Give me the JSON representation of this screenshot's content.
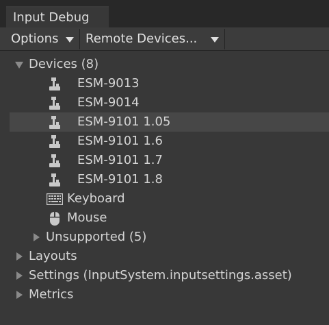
{
  "window": {
    "tab_title": "Input Debug"
  },
  "toolbar": {
    "options_label": "Options",
    "remote_label": "Remote Devices..."
  },
  "tree": {
    "devices": {
      "label": "Devices (8)",
      "items": [
        {
          "label": "ESM-9013",
          "icon": "joystick-icon"
        },
        {
          "label": "ESM-9014",
          "icon": "joystick-icon"
        },
        {
          "label": "ESM-9101 1.05",
          "icon": "joystick-icon",
          "selected": true
        },
        {
          "label": "ESM-9101 1.6",
          "icon": "joystick-icon"
        },
        {
          "label": "ESM-9101 1.7",
          "icon": "joystick-icon"
        },
        {
          "label": "ESM-9101 1.8",
          "icon": "joystick-icon"
        },
        {
          "label": "Keyboard",
          "icon": "keyboard-icon"
        },
        {
          "label": "Mouse",
          "icon": "mouse-icon"
        }
      ],
      "unsupported": "Unsupported (5)"
    },
    "layouts": "Layouts",
    "settings": "Settings (InputSystem.inputsettings.asset)",
    "metrics": "Metrics"
  },
  "colors": {
    "panel_bg": "#383838",
    "selected_row": "#474747",
    "text": "#d4d4d4",
    "arrow": "#8a8a8a"
  }
}
